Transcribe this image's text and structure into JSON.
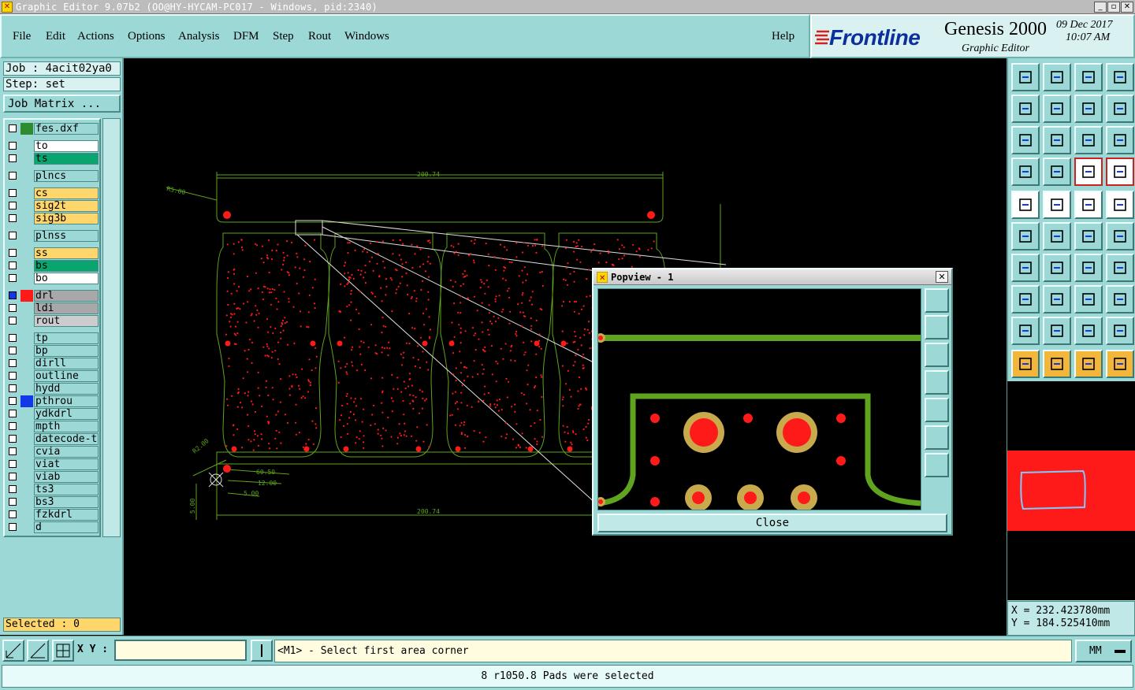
{
  "window": {
    "title": "Graphic Editor 9.07b2 (OO@HY-HYCAM-PC017 - Windows, pid:2340)",
    "minimize": "_",
    "maximize": "▫",
    "close": "✕"
  },
  "menu": {
    "items": [
      "File",
      "Edit",
      "Actions",
      "Options",
      "Analysis",
      "DFM",
      "Step",
      "Rout",
      "Windows"
    ],
    "help": "Help"
  },
  "brand": {
    "logo": "Frontline",
    "product": "Genesis 2000",
    "subtitle": "Graphic Editor",
    "date": "09 Dec 2017",
    "time": "10:07 AM"
  },
  "job": {
    "job_line": "Job : 4acit02ya0",
    "step_line": "Step: set",
    "matrix_button": "Job Matrix ..."
  },
  "layers": [
    {
      "name": "fes.dxf",
      "swatch": "#2e8b2e",
      "bg": "#9cd8d6",
      "checked": false
    },
    {
      "name": "to",
      "swatch": "",
      "bg": "#ffffff",
      "checked": false
    },
    {
      "name": "ts",
      "swatch": "",
      "bg": "#0aa56e",
      "checked": false
    },
    {
      "name": "plncs",
      "swatch": "",
      "bg": "#9cd8d6",
      "checked": false
    },
    {
      "name": "cs",
      "swatch": "",
      "bg": "#ffd66b",
      "checked": false
    },
    {
      "name": "sig2t",
      "swatch": "",
      "bg": "#ffd66b",
      "checked": false
    },
    {
      "name": "sig3b",
      "swatch": "",
      "bg": "#ffd66b",
      "checked": false
    },
    {
      "name": "plnss",
      "swatch": "",
      "bg": "#9cd8d6",
      "checked": false
    },
    {
      "name": "ss",
      "swatch": "",
      "bg": "#ffd66b",
      "checked": false
    },
    {
      "name": "bs",
      "swatch": "",
      "bg": "#0aa56e",
      "checked": false
    },
    {
      "name": "bo",
      "swatch": "",
      "bg": "#ffffff",
      "checked": false
    },
    {
      "name": "drl",
      "swatch": "#ff1a1a",
      "bg": "#a8a8a8",
      "checked": true
    },
    {
      "name": "ldi",
      "swatch": "",
      "bg": "#a8a8a8",
      "checked": false
    },
    {
      "name": "rout",
      "swatch": "",
      "bg": "#cccccc",
      "checked": false
    },
    {
      "name": "tp",
      "swatch": "",
      "bg": "#9cd8d6",
      "checked": false
    },
    {
      "name": "bp",
      "swatch": "",
      "bg": "#9cd8d6",
      "checked": false
    },
    {
      "name": "dirll",
      "swatch": "",
      "bg": "#9cd8d6",
      "checked": false
    },
    {
      "name": "outline",
      "swatch": "",
      "bg": "#9cd8d6",
      "checked": false
    },
    {
      "name": "hydd",
      "swatch": "",
      "bg": "#9cd8d6",
      "checked": false
    },
    {
      "name": "pthrou",
      "swatch": "#1238e8",
      "bg": "#9cd8d6",
      "checked": false
    },
    {
      "name": "ydkdrl",
      "swatch": "",
      "bg": "#9cd8d6",
      "checked": false
    },
    {
      "name": "mpth",
      "swatch": "",
      "bg": "#9cd8d6",
      "checked": false
    },
    {
      "name": "datecode-to",
      "swatch": "",
      "bg": "#9cd8d6",
      "checked": false
    },
    {
      "name": "cvia",
      "swatch": "",
      "bg": "#9cd8d6",
      "checked": false
    },
    {
      "name": "viat",
      "swatch": "",
      "bg": "#9cd8d6",
      "checked": false
    },
    {
      "name": "viab",
      "swatch": "",
      "bg": "#9cd8d6",
      "checked": false
    },
    {
      "name": "ts3",
      "swatch": "",
      "bg": "#9cd8d6",
      "checked": false
    },
    {
      "name": "bs3",
      "swatch": "",
      "bg": "#9cd8d6",
      "checked": false
    },
    {
      "name": "fzkdrl",
      "swatch": "",
      "bg": "#9cd8d6",
      "checked": false
    },
    {
      "name": "d",
      "swatch": "",
      "bg": "#9cd8d6",
      "checked": false
    }
  ],
  "selected": "Selected : 0",
  "canvas": {
    "dim_top": "200.74",
    "dim_bottom": "200.74",
    "dim_angle": "R5.00",
    "dim_r2": "R2.00",
    "dim_a": "60.50",
    "dim_b": "12.00",
    "dim_c": "5.00",
    "dim_d": "5.00"
  },
  "popview": {
    "title": "Popview - 1",
    "close_label": "Close"
  },
  "coords": {
    "x": "X = 232.423780mm",
    "y": "Y = 184.525410mm"
  },
  "bottom": {
    "xy_label": "X Y :",
    "xy_value": "",
    "prompt": "<M1> - Select first area corner",
    "units": "MM",
    "status": "8 r1050.8 Pads were selected"
  },
  "colors": {
    "panel": "#9cd8d6",
    "profile": "#5fa31e",
    "pad": "#ff1a1a",
    "ring": "#c8a94c"
  }
}
